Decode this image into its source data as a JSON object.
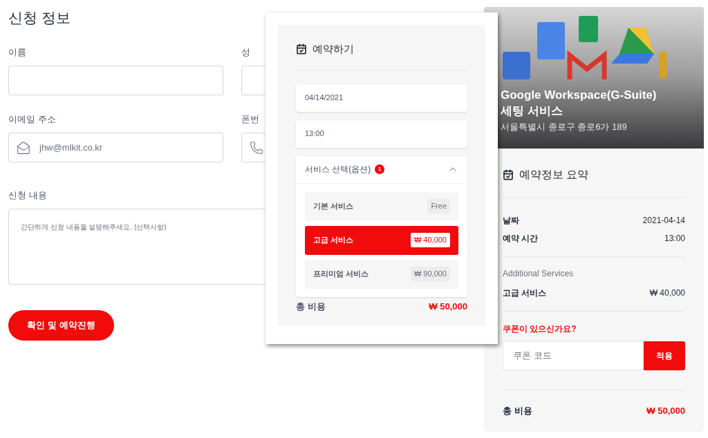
{
  "form": {
    "title": "신청 정보",
    "fields": [
      {
        "label": "이름",
        "kind": "plain"
      },
      {
        "label": "성",
        "kind": "plain"
      },
      {
        "label": "이메일 주소",
        "kind": "email",
        "value": "jhw@mlkit.co.kr"
      },
      {
        "label": "폰번",
        "kind": "phone"
      }
    ],
    "content": {
      "label": "신청 내용",
      "placeholder": "간단하게 신청 내용을 설명해주세요. (선택사항)"
    },
    "submit": "확인 및 예약진행"
  },
  "booking": {
    "title": "예약하기",
    "date": "04/14/2021",
    "time": "13:00",
    "services": {
      "label": "서비스 선택(옵션)",
      "badge": "1",
      "expanded": true,
      "options": [
        {
          "name": "기본 서비스",
          "price": "Free",
          "selected": false
        },
        {
          "name": "고급 서비스",
          "price": "₩ 40,000",
          "selected": true
        },
        {
          "name": "프리미엄 서비스",
          "price": "₩ 90,000",
          "selected": false
        }
      ]
    },
    "total": {
      "label": "총 비용",
      "value": "₩ 50,000"
    }
  },
  "sidebar": {
    "banner": {
      "title": "Google Workspace(G-Suite) 세팅 서비스",
      "address": "서울특별시 종로구 종로6가 189"
    },
    "summary_title": "예약정보 요약",
    "rows": [
      {
        "label": "날짜",
        "value": "2021-04-14"
      },
      {
        "label": "예약 시간",
        "value": "13:00"
      }
    ],
    "additional": {
      "heading": "Additional Services",
      "items": [
        {
          "name": "고급 서비스",
          "price": "₩ 40,000"
        }
      ]
    },
    "coupon": {
      "label": "쿠폰이 있으신가요?",
      "placeholder": "쿠폰 코드",
      "button": "적용"
    },
    "total": {
      "label": "총 비용",
      "value": "₩ 50,000"
    }
  }
}
